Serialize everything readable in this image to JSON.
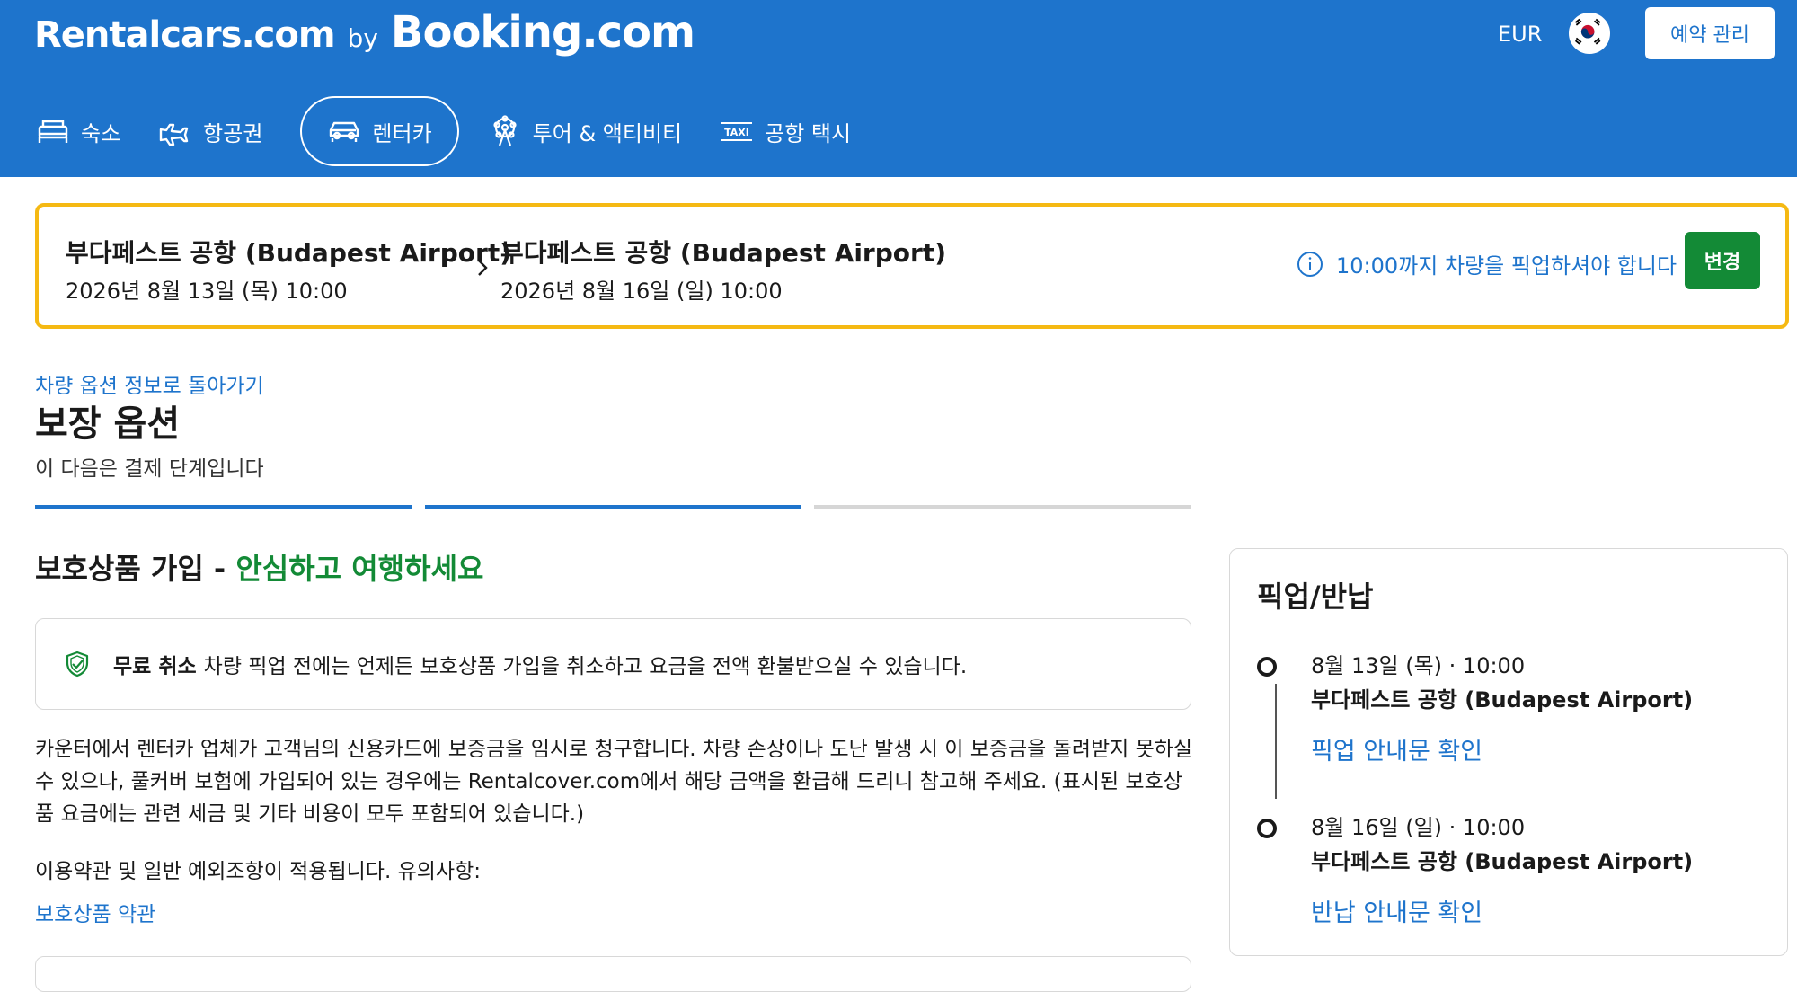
{
  "header": {
    "logo_left": "Rentalcars.com",
    "logo_by": "by",
    "logo_right": "Booking.com",
    "currency": "EUR",
    "manage_label": "예약 관리",
    "nav": [
      {
        "label": "숙소",
        "icon": "bed-icon"
      },
      {
        "label": "항공권",
        "icon": "plane-icon"
      },
      {
        "label": "렌터카",
        "icon": "car-icon"
      },
      {
        "label": "투어 & 액티비티",
        "icon": "attractions-icon"
      },
      {
        "label": "공항 택시",
        "icon": "taxi-icon"
      }
    ],
    "taxi_badge": "TAXI"
  },
  "summary": {
    "pickup_name": "부다페스트 공항 (Budapest Airport)",
    "pickup_date": "2026년 8월 13일 (목) 10:00",
    "dropoff_name": "부다페스트 공항 (Budapest Airport)",
    "dropoff_date": "2026년 8월 16일 (일) 10:00",
    "pickup_note": "10:00까지 차량을 픽업하셔야 합니다",
    "change_label": "변경"
  },
  "main": {
    "back_link": "차량 옵션 정보로 돌아가기",
    "title": "보장 옵션",
    "subtitle": "이 다음은 결제 단계입니다",
    "section_title_prefix": "보호상품 가입 - ",
    "section_title_highlight": "안심하고 여행하세요",
    "free_cancel_bold": "무료 취소",
    "free_cancel_text": "차량 픽업 전에는 언제든 보호상품 가입을 취소하고 요금을 전액 환불받으실 수 있습니다.",
    "paragraph": "카운터에서 렌터카 업체가 고객님의 신용카드에 보증금을 임시로 청구합니다. 차량 손상이나 도난 발생 시 이 보증금을 돌려받지 못하실 수 있으나, 풀커버 보험에 가입되어 있는 경우에는 Rentalcover.com에서 해당 금액을 환급해 드리니 참고해 주세요. (표시된 보호상품 요금에는 관련 세금 및 기타 비용이 모두 포함되어 있습니다.)",
    "terms_intro": "이용약관 및 일반 예외조항이 적용됩니다. 유의사항:",
    "terms_link": "보호상품 약관"
  },
  "side": {
    "title": "픽업/반납",
    "pickup_datetime": "8월 13일 (목) · 10:00",
    "pickup_place": "부다페스트 공항 (Budapest Airport)",
    "pickup_link": "픽업 안내문 확인",
    "dropoff_datetime": "8월 16일 (일) · 10:00",
    "dropoff_place": "부다페스트 공항 (Budapest Airport)",
    "dropoff_link": "반납 안내문 확인"
  },
  "colors": {
    "brand_blue": "#1e74cc",
    "accent_green": "#138a36",
    "summary_border": "#f5b913"
  }
}
